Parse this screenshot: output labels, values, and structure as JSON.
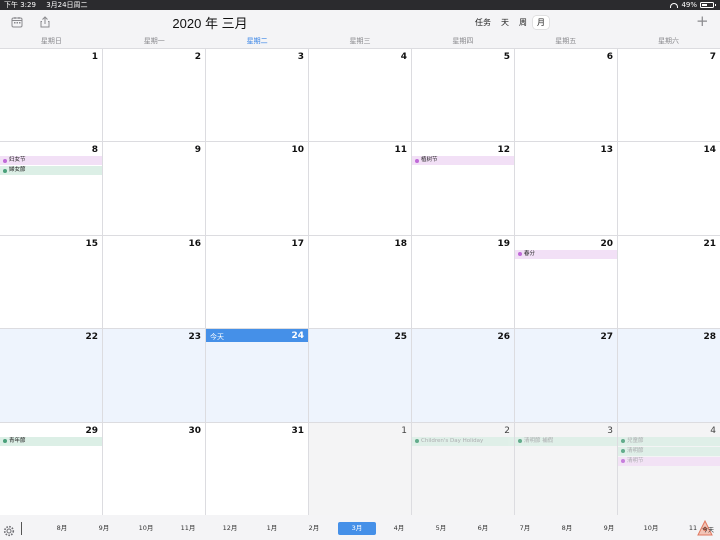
{
  "status": {
    "time": "下午 3:29",
    "date": "3月24日周二",
    "battery": "49%",
    "battery_level": 0.49
  },
  "header": {
    "title": "2020 年 三月",
    "views": [
      "任务",
      "天",
      "周",
      "月"
    ],
    "active_view": "月"
  },
  "weekdays": [
    "星期日",
    "星期一",
    "星期二",
    "星期三",
    "星期四",
    "星期五",
    "星期六"
  ],
  "current_weekday_index": 2,
  "today_label": "今天",
  "weeks": [
    [
      {
        "day": "1"
      },
      {
        "day": "2"
      },
      {
        "day": "3"
      },
      {
        "day": "4"
      },
      {
        "day": "5"
      },
      {
        "day": "6"
      },
      {
        "day": "7"
      }
    ],
    [
      {
        "day": "8",
        "events": [
          {
            "title": "妇女节",
            "color": "p"
          },
          {
            "title": "婦女節",
            "color": "g"
          }
        ]
      },
      {
        "day": "9"
      },
      {
        "day": "10"
      },
      {
        "day": "11"
      },
      {
        "day": "12",
        "events": [
          {
            "title": "植树节",
            "color": "p"
          }
        ]
      },
      {
        "day": "13"
      },
      {
        "day": "14"
      }
    ],
    [
      {
        "day": "15"
      },
      {
        "day": "16"
      },
      {
        "day": "17"
      },
      {
        "day": "18"
      },
      {
        "day": "19"
      },
      {
        "day": "20",
        "events": [
          {
            "title": "春分",
            "color": "p"
          }
        ]
      },
      {
        "day": "21"
      }
    ],
    [
      {
        "day": "22",
        "thisweek": true
      },
      {
        "day": "23",
        "thisweek": true
      },
      {
        "day": "24",
        "thisweek": true,
        "today": true
      },
      {
        "day": "25",
        "thisweek": true
      },
      {
        "day": "26",
        "thisweek": true
      },
      {
        "day": "27",
        "thisweek": true
      },
      {
        "day": "28",
        "thisweek": true
      }
    ],
    [
      {
        "day": "29",
        "events": [
          {
            "title": "青年節",
            "color": "g"
          }
        ]
      },
      {
        "day": "30"
      },
      {
        "day": "31"
      },
      {
        "day": "1",
        "next": true
      },
      {
        "day": "2",
        "next": true,
        "events": [
          {
            "title": "Children's Day Holiday",
            "color": "g"
          }
        ]
      },
      {
        "day": "3",
        "next": true,
        "events": [
          {
            "title": "清明節 補假",
            "color": "g"
          }
        ]
      },
      {
        "day": "4",
        "next": true,
        "events": [
          {
            "title": "兒童節",
            "color": "g"
          },
          {
            "title": "清明節",
            "color": "g"
          },
          {
            "title": "清明节",
            "color": "p"
          }
        ]
      }
    ]
  ],
  "months": [
    "8月",
    "9月",
    "10月",
    "11月",
    "12月",
    "1月",
    "2月",
    "3月",
    "4月",
    "5月",
    "6月",
    "7月",
    "8月",
    "9月",
    "10月",
    "11"
  ],
  "active_month_index": 7,
  "corner_label": "今天",
  "colors": {
    "accent": "#4590e8",
    "purple_event": "#f2e0f6",
    "green_event": "#dcefe6"
  }
}
